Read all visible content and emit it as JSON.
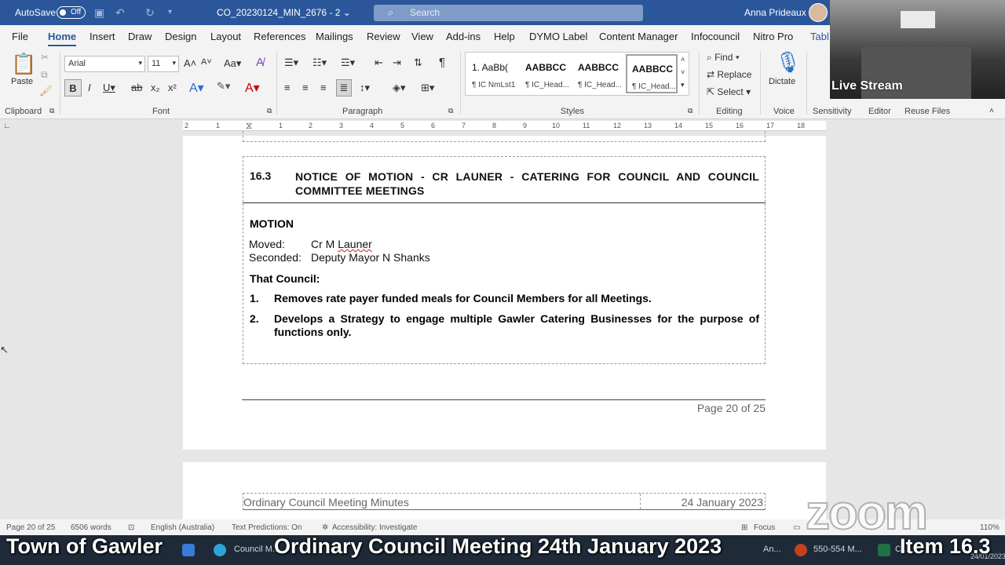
{
  "titlebar": {
    "autosave_label": "AutoSave",
    "autosave_state": "Off",
    "document_name": "CO_20230124_MIN_2676  -  2 ⌄",
    "search_placeholder": "Search",
    "user_name": "Anna Prideaux"
  },
  "menu_tabs": [
    "File",
    "Home",
    "Insert",
    "Draw",
    "Design",
    "Layout",
    "References",
    "Mailings",
    "Review",
    "View",
    "Add-ins",
    "Help",
    "DYMO Label",
    "Content Manager",
    "Infocouncil",
    "Nitro Pro",
    "Tabl"
  ],
  "active_tab": "Home",
  "ribbon": {
    "clipboard": {
      "paste_label": "Paste",
      "group_label": "Clipboard"
    },
    "font": {
      "font_name": "Arial",
      "font_size": "11",
      "group_label": "Font"
    },
    "paragraph": {
      "group_label": "Paragraph"
    },
    "styles": {
      "group_label": "Styles",
      "items": [
        {
          "preview": "1.  AaBb(",
          "name": "¶ IC NmLst1"
        },
        {
          "preview": "AABBCC",
          "name": "¶ IC_Head..."
        },
        {
          "preview": "AABBCC",
          "name": "¶ IC_Head..."
        },
        {
          "preview": "AABBCC",
          "name": "¶ IC_Head..."
        }
      ]
    },
    "editing": {
      "find": "Find",
      "replace": "Replace",
      "select": "Select",
      "group_label": "Editing"
    },
    "voice": {
      "dictate": "Dictate",
      "group_label": "Voice"
    },
    "sensitivity_label": "Sensitivity",
    "editor_label": "Editor",
    "reuse_label": "Reuse Files"
  },
  "inset_video": {
    "label": "Live Stream"
  },
  "ruler_numbers": [
    "2",
    "1",
    "1",
    "2",
    "3",
    "4",
    "5",
    "6",
    "7",
    "8",
    "9",
    "10",
    "11",
    "12",
    "13",
    "14",
    "15",
    "16",
    "17",
    "18"
  ],
  "document": {
    "item_number": "16.3",
    "item_title": "NOTICE OF MOTION - CR LAUNER - CATERING FOR COUNCIL AND COUNCIL COMMITTEE MEETINGS",
    "motion_heading": "MOTION",
    "moved_label": "Moved:",
    "moved_prefix": "Cr M ",
    "moved_name": "Launer",
    "seconded_label": "Seconded:",
    "seconded_value": "Deputy Mayor N Shanks",
    "that_council": "That Council:",
    "list": [
      {
        "num": "1.",
        "text": "Removes rate payer funded meals for Council Members for all Meetings."
      },
      {
        "num": "2.",
        "text": "Develops a Strategy to engage multiple Gawler Catering Businesses for the purpose of functions only."
      }
    ],
    "page_number": "Page 20 of 25",
    "next_header_left": "Ordinary Council Meeting Minutes",
    "next_header_right": "24 January 2023"
  },
  "statusbar": {
    "page": "Page 20 of 25",
    "words": "6506 words",
    "language": "English (Australia)",
    "predictions": "Text Predictions: On",
    "accessibility": "Accessibility: Investigate",
    "focus": "Focus",
    "zoom": "110%"
  },
  "taskbar": {
    "items": [
      "Council M...",
      "An...",
      "550-554 M...",
      "C..."
    ],
    "date": "24/01/2023"
  },
  "caption": {
    "left": "Town of Gawler",
    "center": "Ordinary Council Meeting 24th January 2023",
    "right": "Item 16.3"
  },
  "watermark": "zoom",
  "colors": {
    "word_blue": "#2b579a",
    "taskbar": "#1e2a38"
  }
}
